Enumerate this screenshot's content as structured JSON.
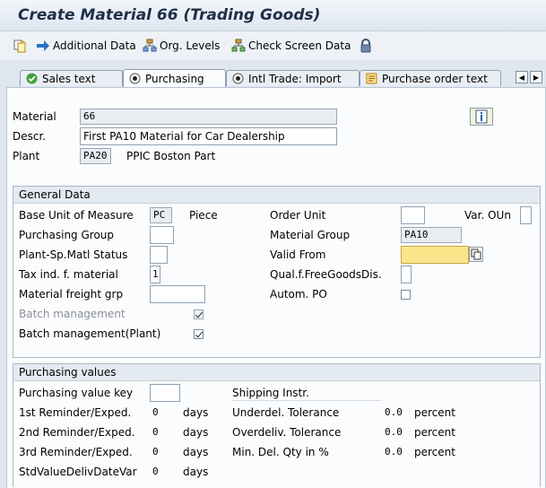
{
  "title": "Create Material 66 (Trading Goods)",
  "toolbar": {
    "additional_data": "Additional Data",
    "org_levels": "Org. Levels",
    "check_screen_data": "Check Screen Data"
  },
  "tabs": [
    {
      "label": "Sales text",
      "icon": "check-icon"
    },
    {
      "label": "Purchasing",
      "icon": "radio-icon",
      "active": true
    },
    {
      "label": "Intl Trade: Import",
      "icon": "radio-icon"
    },
    {
      "label": "Purchase order text",
      "icon": "note-icon"
    }
  ],
  "header": {
    "material_label": "Material",
    "material_value": "66",
    "descr_label": "Descr.",
    "descr_value": "First PA10 Material for Car Dealership",
    "plant_label": "Plant",
    "plant_value": "PA20",
    "plant_name": "PPIC Boston Part"
  },
  "general": {
    "title": "General Data",
    "base_uom_label": "Base Unit of Measure",
    "base_uom_value": "PC",
    "base_uom_text": "Piece",
    "order_unit_label": "Order Unit",
    "var_oun_label": "Var. OUn",
    "purch_group_label": "Purchasing Group",
    "material_group_label": "Material Group",
    "material_group_value": "PA10",
    "plant_status_label": "Plant-Sp.Matl Status",
    "valid_from_label": "Valid From",
    "tax_label": "Tax ind. f. material",
    "tax_value": "1",
    "qual_label": "Qual.f.FreeGoodsDis.",
    "freight_label": "Material freight grp",
    "autom_po_label": "Autom. PO",
    "batch_label": "Batch management",
    "batch_plant_label": "Batch management(Plant)"
  },
  "purchasing": {
    "title": "Purchasing values",
    "value_key_label": "Purchasing value key",
    "shipping_label": "Shipping Instr.",
    "reminder1_label": "1st Reminder/Exped.",
    "reminder1_value": "0",
    "reminder2_label": "2nd Reminder/Exped.",
    "reminder2_value": "0",
    "reminder3_label": "3rd Reminder/Exped.",
    "reminder3_value": "0",
    "stdvalue_label": "StdValueDelivDateVar",
    "stdvalue_value": "0",
    "days": "days",
    "underdel_label": "Underdel. Tolerance",
    "underdel_value": "0.0",
    "overdel_label": "Overdeliv. Tolerance",
    "overdel_value": "0.0",
    "mindel_label": "Min. Del. Qty in %",
    "mindel_value": "0.0",
    "percent": "percent"
  }
}
